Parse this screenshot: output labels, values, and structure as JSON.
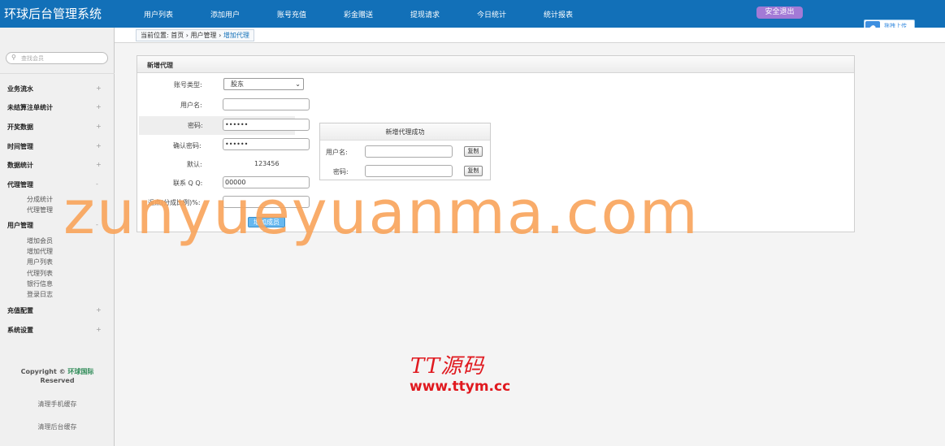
{
  "app": {
    "title": "环球后台管理系统"
  },
  "nav": {
    "items": [
      "用户列表",
      "添加用户",
      "账号充值",
      "彩金赠送",
      "提现请求",
      "今日统计",
      "统计报表"
    ],
    "logout": "安全退出"
  },
  "cloud": {
    "label": "拖拽上传"
  },
  "sidebar": {
    "search_placeholder": "查找会员",
    "menus": [
      {
        "label": "业务流水",
        "toggle": "+"
      },
      {
        "label": "未结算注单统计",
        "toggle": "+"
      },
      {
        "label": "开奖数据",
        "toggle": "+"
      },
      {
        "label": "时间管理",
        "toggle": "+"
      },
      {
        "label": "数据统计",
        "toggle": "+"
      },
      {
        "label": "代理管理",
        "toggle": "-"
      },
      {
        "label": "用户管理",
        "toggle": "-"
      },
      {
        "label": "充值配置",
        "toggle": "+"
      },
      {
        "label": "系统设置",
        "toggle": "+"
      }
    ],
    "agent_sub": [
      "分成统计",
      "代理管理"
    ],
    "user_sub": [
      "增加会员",
      "增加代理",
      "用户列表",
      "代理列表",
      "银行信息",
      "登录日志"
    ],
    "copyright": {
      "prefix": "Copyright ©",
      "company": "环球国际",
      "suffix": "Reserved"
    },
    "clear_mobile": "清理手机缓存",
    "clear_admin": "清理后台缓存"
  },
  "breadcrumb": {
    "prefix": "当前位置:",
    "items": [
      "首页",
      "用户管理"
    ],
    "current": "增加代理"
  },
  "form": {
    "title": "新增代理",
    "account_type_label": "账号类型:",
    "account_type_value": "股东",
    "username_label": "用户名:",
    "username_value": "",
    "password_label": "密码:",
    "password_value": "••••••",
    "confirm_label": "确认密码:",
    "confirm_value": "••••••",
    "default_label": "默认:",
    "default_value": "123456",
    "qq_label": "联系 Q Q:",
    "qq_value": "00000",
    "rebate_label": "返点(分成比例)%:",
    "rebate_value": "",
    "submit": "增加成员"
  },
  "success": {
    "title": "新增代理成功",
    "username_label": "用户名:",
    "password_label": "密码:",
    "copy1": "复制",
    "copy2": "复制"
  },
  "watermark": {
    "text": "zunyueyuanma.com",
    "logo": "TT源码",
    "url": "www.ttym.cc"
  },
  "colors": {
    "topbar": "#1270b8",
    "logout": "#a37ad6",
    "watermark": "#f9a45a",
    "logo": "#e0191f"
  }
}
